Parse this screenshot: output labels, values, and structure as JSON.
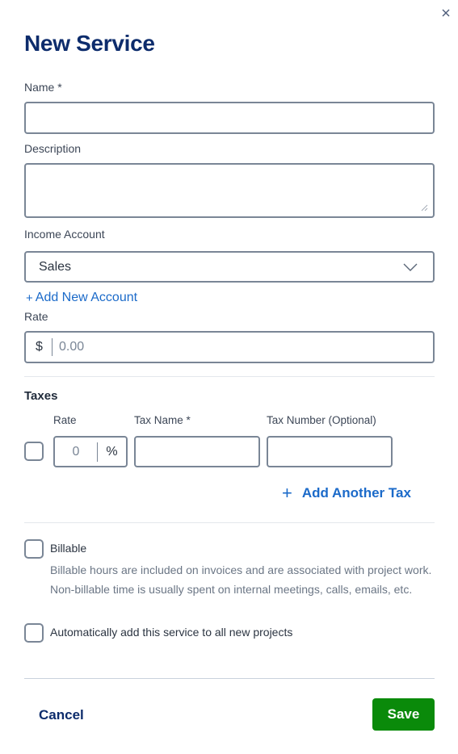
{
  "dialog": {
    "title": "New Service",
    "close_icon": "close-icon"
  },
  "form": {
    "name": {
      "label": "Name *",
      "value": ""
    },
    "description": {
      "label": "Description",
      "value": ""
    },
    "income_account": {
      "label": "Income Account",
      "selected": "Sales",
      "icon": "chevron-down-icon"
    },
    "add_account_link": {
      "plus": "+",
      "label": "Add New Account"
    },
    "rate": {
      "label": "Rate",
      "currency": "$",
      "placeholder": "0.00"
    }
  },
  "taxes": {
    "title": "Taxes",
    "columns": {
      "rate": "Rate",
      "tax_name": "Tax Name *",
      "tax_number": "Tax Number (Optional)"
    },
    "rows": [
      {
        "checked": false,
        "rate_placeholder": "0",
        "rate_unit": "%",
        "tax_name": "",
        "tax_number": ""
      }
    ],
    "add_tax": {
      "plus": "+",
      "label": "Add Another Tax"
    }
  },
  "options": {
    "billable": {
      "label": "Billable",
      "checked": false,
      "help": "Billable hours are included on invoices and are associated with project work. Non-billable time is usually spent on internal meetings, calls, emails, etc."
    },
    "auto_add": {
      "label": "Automatically add this service to all new projects",
      "checked": false
    }
  },
  "footer": {
    "cancel_label": "Cancel",
    "save_label": "Save"
  },
  "colors": {
    "title": "#0d2c6c",
    "link": "#1b6ac9",
    "save": "#0a8a0a",
    "border": "#7a8696"
  }
}
